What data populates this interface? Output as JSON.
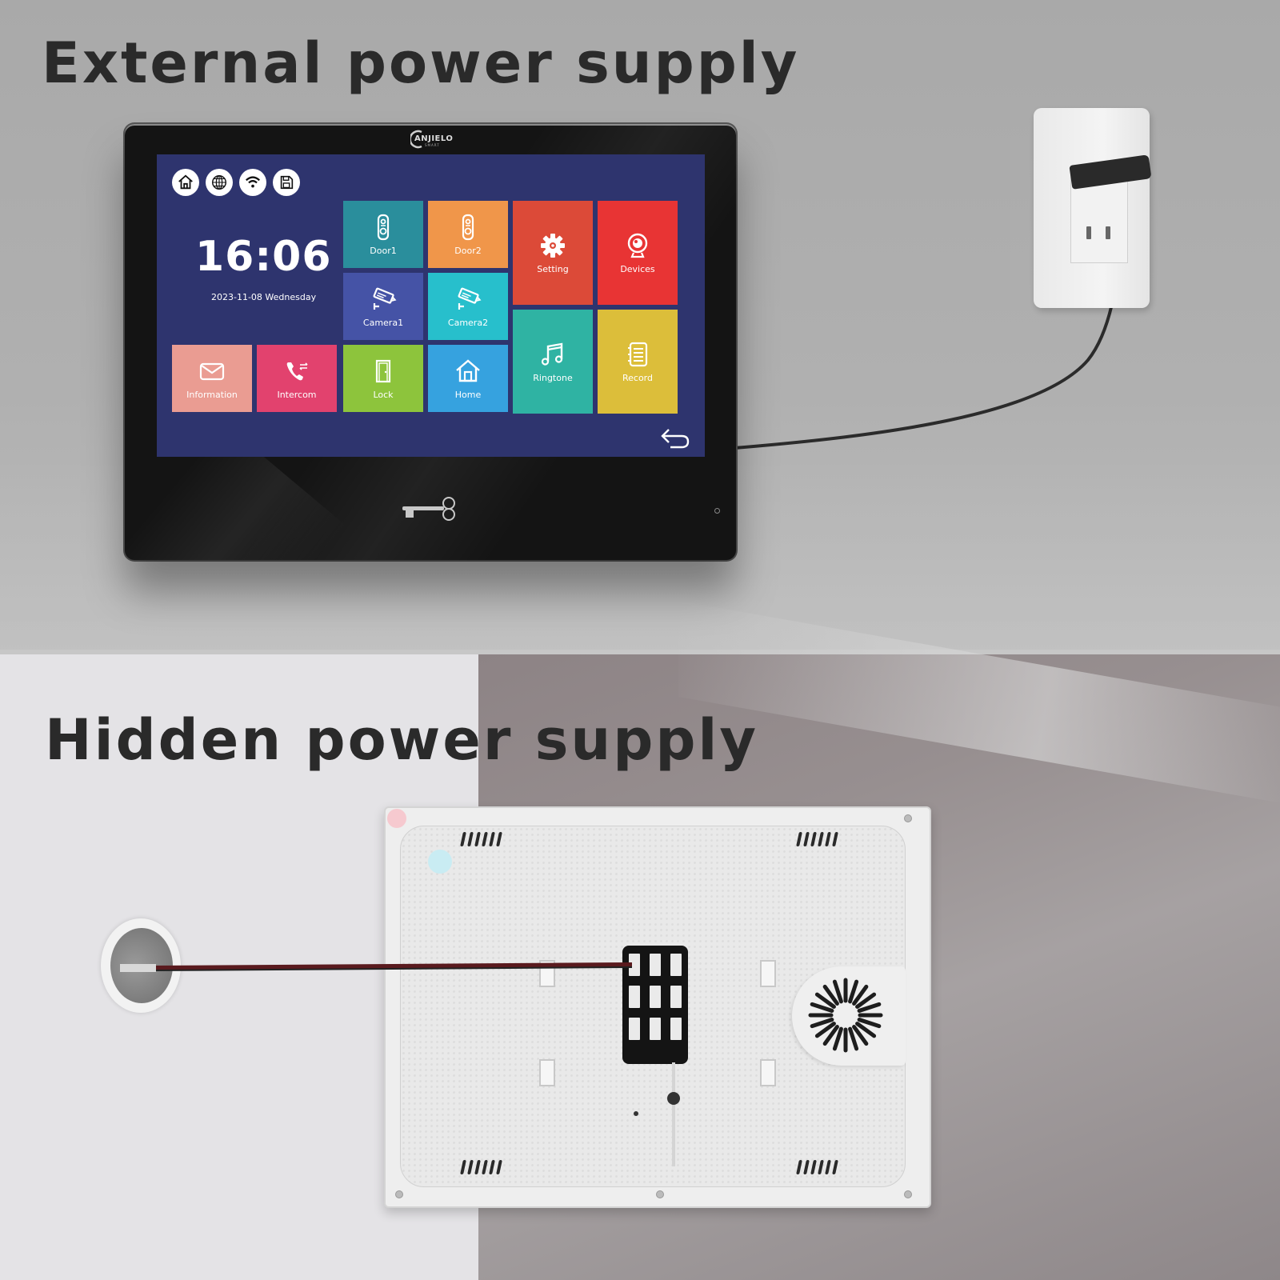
{
  "headings": {
    "top": "External power supply",
    "bottom": "Hidden power supply"
  },
  "device": {
    "brand": "ANJIELO",
    "brand_sub": "SMART"
  },
  "screen": {
    "status_icons": [
      "home-icon",
      "globe-icon",
      "wifi-icon",
      "save-icon"
    ],
    "clock": "16:06",
    "date": "2023-11-08 Wednesday",
    "tiles": [
      {
        "id": "door1",
        "label": "Door1",
        "icon": "doorbell-icon",
        "color": "#2a8e9c"
      },
      {
        "id": "door2",
        "label": "Door2",
        "icon": "doorbell-icon",
        "color": "#f0964a"
      },
      {
        "id": "setting",
        "label": "Setting",
        "icon": "gear-icon",
        "color": "#dc4a38"
      },
      {
        "id": "devices",
        "label": "Devices",
        "icon": "webcam-icon",
        "color": "#e83434"
      },
      {
        "id": "camera1",
        "label": "Camera1",
        "icon": "cctv-camera-icon",
        "color": "#4553a6"
      },
      {
        "id": "camera2",
        "label": "Camera2",
        "icon": "cctv-camera-icon",
        "color": "#27bfcc"
      },
      {
        "id": "ringtone",
        "label": "Ringtone",
        "icon": "music-note-icon",
        "color": "#2fb3a3"
      },
      {
        "id": "record",
        "label": "Record",
        "icon": "notebook-icon",
        "color": "#dcbe3a"
      },
      {
        "id": "information",
        "label": "Information",
        "icon": "envelope-icon",
        "color": "#ea9c92"
      },
      {
        "id": "intercom",
        "label": "Intercom",
        "icon": "phone-transfer-icon",
        "color": "#e2426e"
      },
      {
        "id": "lock",
        "label": "Lock",
        "icon": "door-icon",
        "color": "#8dc43c"
      },
      {
        "id": "home",
        "label": "Home",
        "icon": "house-icon",
        "color": "#36a2df"
      }
    ],
    "back_icon": "back-arrow-icon",
    "background_color": "#2e346e"
  }
}
